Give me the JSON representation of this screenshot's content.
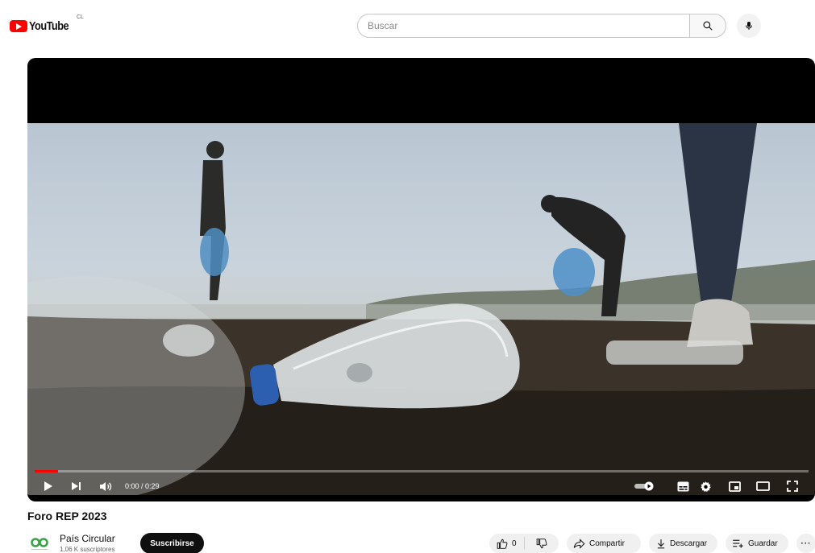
{
  "header": {
    "logo_text": "YouTube",
    "country_code": "CL",
    "search_placeholder": "Buscar",
    "icons": {
      "search": "search-icon",
      "mic": "microphone-icon"
    }
  },
  "player": {
    "progress": 0.03,
    "time_current": "0:00",
    "time_total": "0:29",
    "time_display": "0:00 / 0:29",
    "icons": [
      "play-icon",
      "next-icon",
      "volume-icon",
      "autoplay-toggle-icon",
      "subtitles-icon",
      "settings-icon",
      "miniplayer-icon",
      "theater-mode-icon",
      "fullscreen-icon"
    ],
    "colors": {
      "progress": "#ff0000",
      "background": "#000000"
    }
  },
  "video": {
    "title": "Foro REP 2023"
  },
  "channel": {
    "name": "País Circular",
    "subscribers": "1,06 K suscriptores",
    "subscribe_label": "Suscribirse"
  },
  "actions": {
    "like_count": "0",
    "share_label": "Compartir",
    "download_label": "Descargar",
    "save_label": "Guardar",
    "more_label": "···"
  },
  "colors": {
    "brand": "#ff0000",
    "accent_channel": "#3aa34a"
  }
}
